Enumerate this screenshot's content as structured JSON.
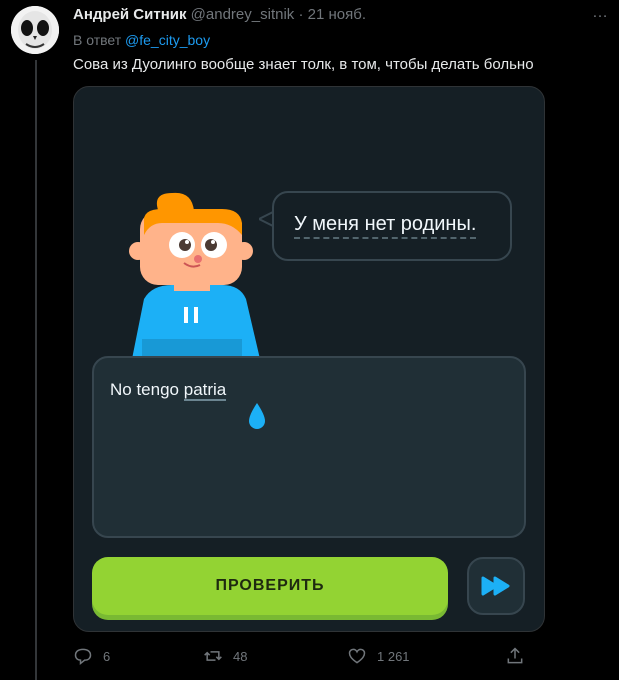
{
  "tweet": {
    "author_name": "Андрей Ситник",
    "handle": "@andrey_sitnik",
    "separator": "·",
    "date": "21 нояб.",
    "more_icon": "…",
    "reply_prefix": "В ответ",
    "reply_to": "@fe_city_boy",
    "text": "Сова из Дуолинго вообще знает толк, в том, чтобы делать больно"
  },
  "card": {
    "prompt_text": "У меня нет родины.",
    "answer_text_prefix": "No tengo ",
    "answer_text_word": "patria",
    "check_button_label": "ПРОВЕРИТЬ",
    "speed_icon": "fast-forward-icon",
    "colors": {
      "background": "#151f25",
      "check_button": "#93d333",
      "accent_blue": "#1cb0f6"
    }
  },
  "actions": {
    "replies": "6",
    "retweets": "48",
    "likes": "1 261"
  },
  "colors": {
    "link": "#1d9bf0",
    "muted": "#71767b",
    "text": "#e7e9ea"
  }
}
